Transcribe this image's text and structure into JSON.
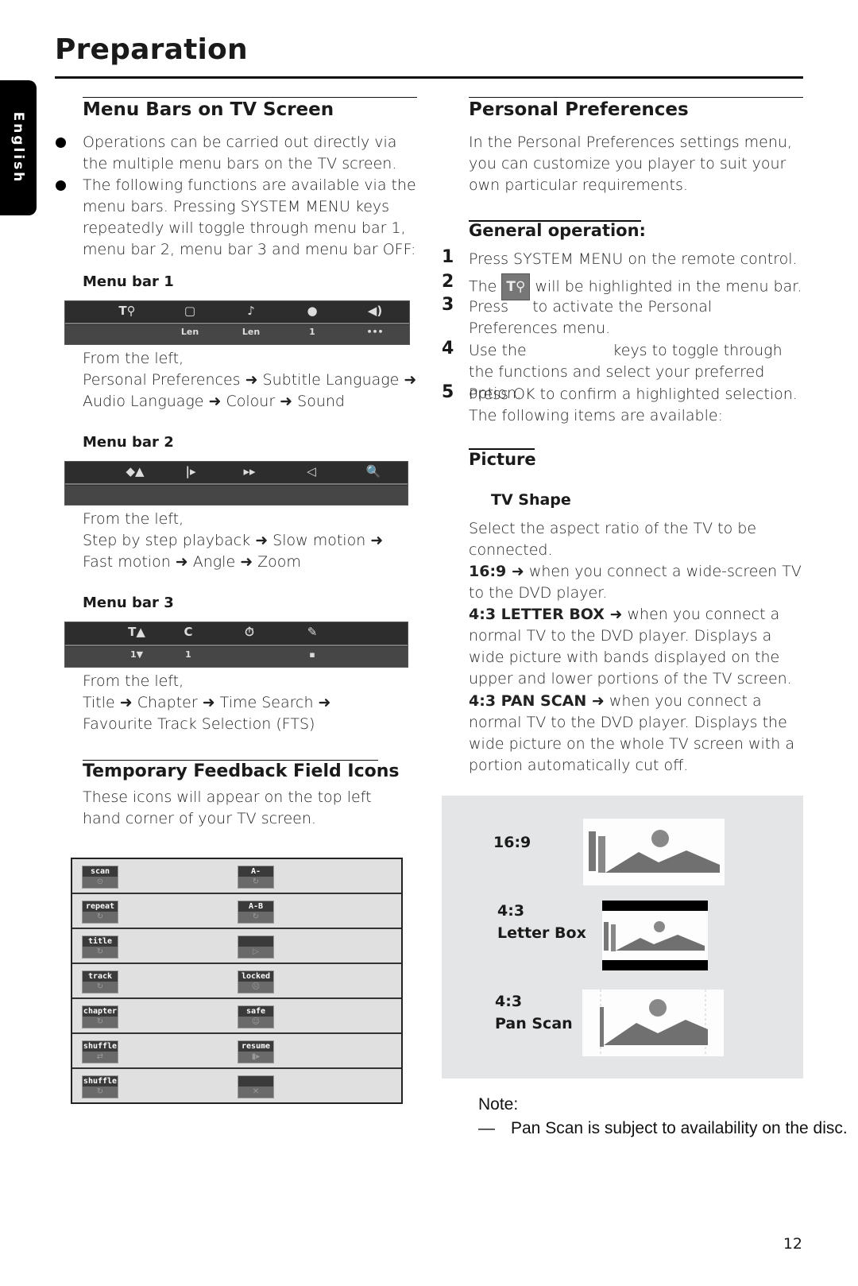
{
  "page": {
    "title": "Preparation",
    "language_tab": "English",
    "page_number": "12"
  },
  "left": {
    "menu_bars_section": {
      "heading": "Menu Bars on TV Screen",
      "bullets": [
        "Operations can be carried out directly via the multiple menu bars on the TV screen.",
        "The following functions are available via the menu bars. Pressing SYSTEM MENU keys repeatedly will toggle through menu bar 1, menu bar 2, menu bar 3 and menu bar OFF:"
      ],
      "menu_bars": [
        {
          "label": "Menu bar 1",
          "icons": [
            "personal-preferences-icon",
            "subtitle-icon",
            "audio-language-icon",
            "colour-icon",
            "sound-icon"
          ],
          "icon_glyphs": [
            "T⚲",
            "▢",
            "♪",
            "●",
            "◀)"
          ],
          "lower_values": [
            "Len",
            "Len",
            "1",
            "•••"
          ],
          "from_label": "From the left,",
          "description_lines": [
            "Personal Preferences ➜ Subtitle Language ➜",
            "Audio Language ➜ Colour ➜ Sound"
          ]
        },
        {
          "label": "Menu bar 2",
          "icons": [
            "step-playback-icon",
            "slow-motion-icon",
            "fast-motion-icon",
            "angle-icon",
            "zoom-icon"
          ],
          "icon_glyphs": [
            "◆▲",
            "|▸",
            "▸▸",
            "◁",
            "🔍"
          ],
          "lower_values": [],
          "from_label": "From the left,",
          "description_lines": [
            "Step by step playback ➜ Slow motion ➜",
            "Fast motion ➜ Angle ➜ Zoom"
          ]
        },
        {
          "label": "Menu bar 3",
          "icons": [
            "title-icon",
            "chapter-icon",
            "time-search-icon",
            "fts-icon"
          ],
          "icon_glyphs": [
            "T▲",
            "C",
            "⏱",
            "✎"
          ],
          "lower_values": [
            "1▼",
            "1",
            "",
            "▪"
          ],
          "from_label": "From the left,",
          "description_lines": [
            "Title ➜ Chapter ➜ Time Search ➜",
            "Favourite Track Selection (FTS)"
          ]
        }
      ]
    },
    "feedback_section": {
      "heading": "Temporary Feedback Field Icons",
      "text": "These icons will appear on the top left hand corner of your TV screen.",
      "rows": [
        {
          "left": {
            "label": "scan",
            "glyph": "⊙"
          },
          "right": {
            "label": "A-",
            "glyph": "↻"
          }
        },
        {
          "left": {
            "label": "repeat",
            "glyph": "↻"
          },
          "right": {
            "label": "A-B",
            "glyph": "↻"
          }
        },
        {
          "left": {
            "label": "title",
            "glyph": "↻"
          },
          "right": {
            "label": "",
            "glyph": "▷"
          }
        },
        {
          "left": {
            "label": "track",
            "glyph": "↻"
          },
          "right": {
            "label": "locked",
            "glyph": "☹"
          }
        },
        {
          "left": {
            "label": "chapter",
            "glyph": "↻"
          },
          "right": {
            "label": "safe",
            "glyph": "☺"
          }
        },
        {
          "left": {
            "label": "shuffle",
            "glyph": "⇄"
          },
          "right": {
            "label": "resume",
            "glyph": "▮▸"
          }
        },
        {
          "left": {
            "label": "shuffle",
            "glyph": "↻"
          },
          "right": {
            "label": "",
            "glyph": "✕"
          }
        }
      ]
    }
  },
  "right": {
    "personal_prefs": {
      "heading": "Personal Preferences",
      "intro": "In the Personal Preferences settings menu, you can customize you player to suit your own particular requirements."
    },
    "general_operation": {
      "heading": "General operation:",
      "steps": [
        {
          "num": "1",
          "text": "Press SYSTEM MENU on the remote control."
        },
        {
          "num": "2",
          "pre": "The",
          "icon": "personal-preferences-icon",
          "icon_glyph": "T⚲",
          "post": "will be highlighted in the menu bar."
        },
        {
          "num": "3",
          "text": "Press     to activate the Personal Preferences menu."
        },
        {
          "num": "4",
          "text": "Use the                  keys to toggle through the functions and select your preferred option."
        },
        {
          "num": "5",
          "text": "Press OK to confirm a highlighted selection. The following items are available:"
        }
      ]
    },
    "picture": {
      "heading": "Picture",
      "subheading": "TV Shape",
      "intro": "Select the aspect ratio of the TV to be connected.",
      "options": [
        {
          "term": "16:9 ➜",
          "text": " when you connect a wide-screen TV to the DVD player."
        },
        {
          "term": "4:3 LETTER BOX ➜",
          "text": " when you connect a normal TV to the DVD player. Displays a wide picture with bands displayed on the upper and lower portions of the TV screen."
        },
        {
          "term": "4:3 PAN SCAN ➜",
          "text": " when you connect a normal TV to the DVD player. Displays the wide picture on the whole TV screen with a portion automatically cut off."
        }
      ],
      "illustrations": [
        {
          "line1": "16:9",
          "line2": ""
        },
        {
          "line1": "4:3",
          "line2": "Letter Box"
        },
        {
          "line1": "4:3",
          "line2": "Pan Scan"
        }
      ]
    },
    "note": {
      "label": "Note:",
      "dash": "—",
      "text": "Pan Scan is subject to availability on the disc."
    }
  }
}
